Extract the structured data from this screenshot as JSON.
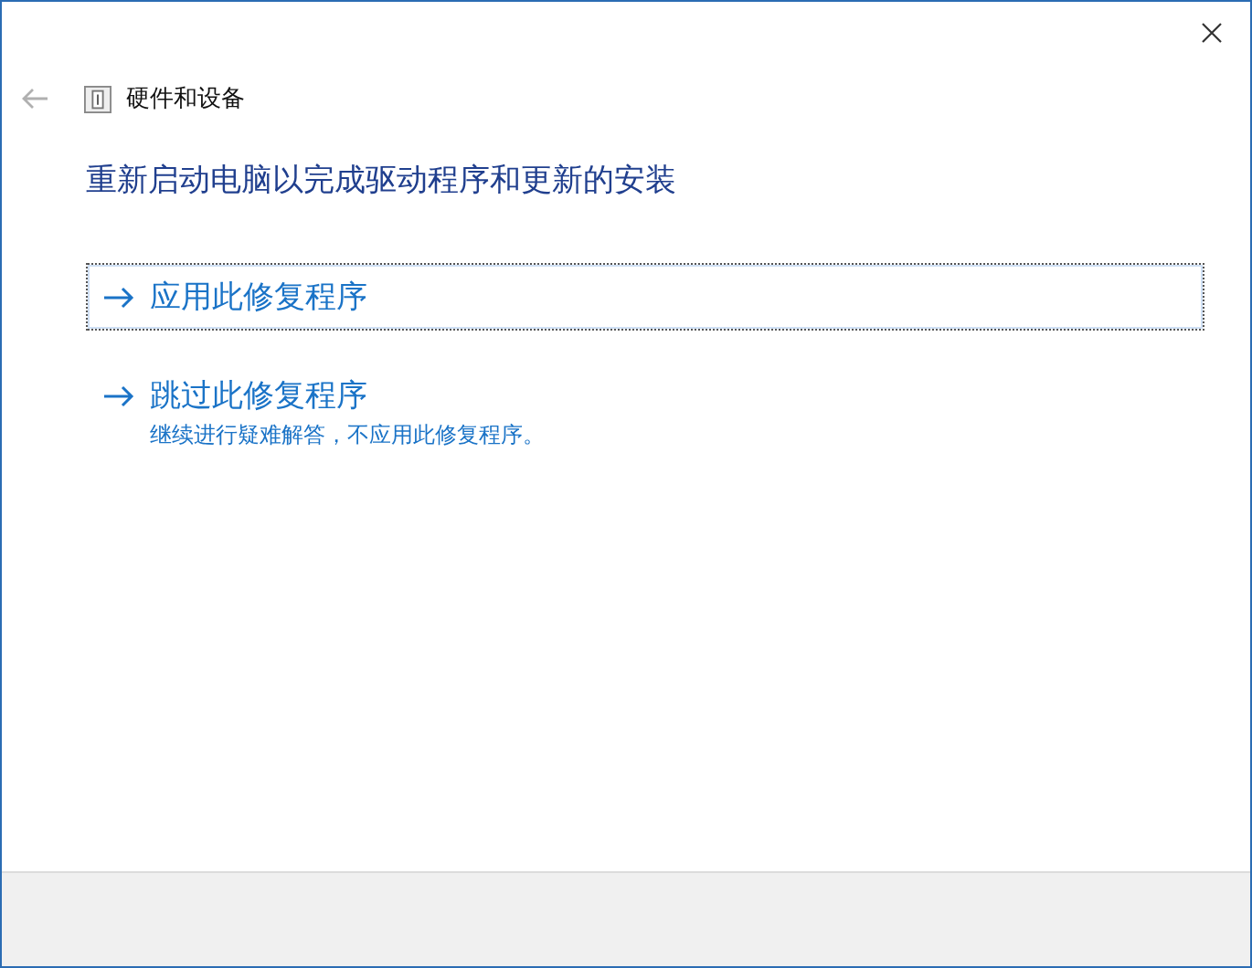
{
  "window": {
    "title": "硬件和设备"
  },
  "heading": "重新启动电脑以完成驱动程序和更新的安装",
  "options": [
    {
      "label": "应用此修复程序",
      "selected": true
    },
    {
      "label": "跳过此修复程序",
      "description": "继续进行疑难解答，不应用此修复程序。",
      "selected": false
    }
  ]
}
